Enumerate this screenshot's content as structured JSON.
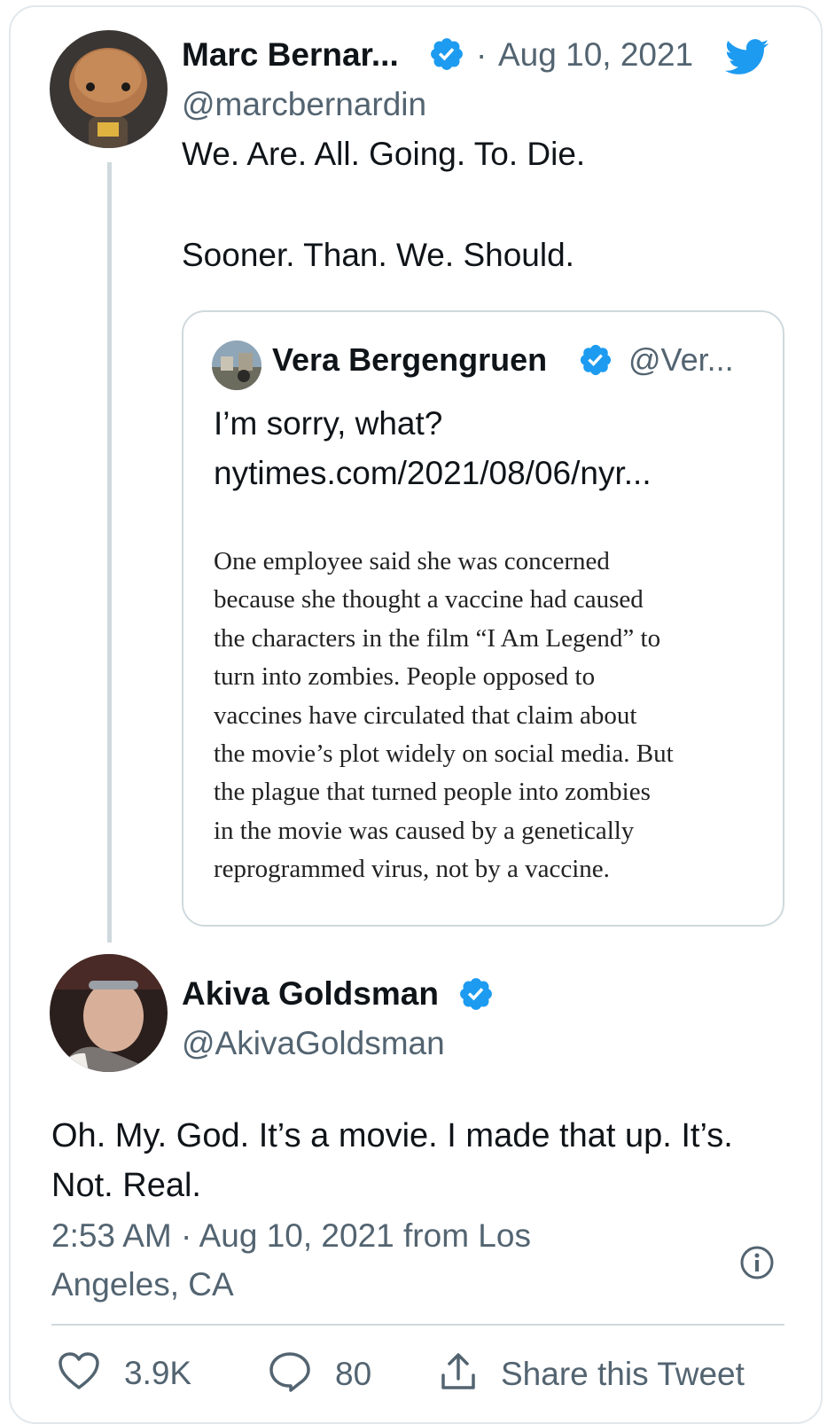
{
  "tweet1": {
    "display_name": "Marc Bernar...",
    "separator": "·",
    "date": "Aug 10, 2021",
    "handle": "@marcbernardin",
    "text_line1": "We. Are. All. Going. To. Die.",
    "text_line2": "Sooner. Than. We. Should."
  },
  "quoted": {
    "display_name": "Vera Bergengruen",
    "handle": "@Ver...",
    "text": "I’m sorry, what?",
    "link": "nytimes.com/2021/08/06/nyr...",
    "article_lines": [
      "One employee said she was concerned",
      "because she thought a vaccine had caused",
      "the characters in the film “I Am Legend” to",
      "turn into zombies. People opposed to",
      "vaccines have circulated that claim about",
      "the movie’s plot widely on social media. But",
      "the plague that turned people into zombies",
      "in the movie was caused by a genetically",
      "reprogrammed virus, not by a vaccine."
    ]
  },
  "tweet2": {
    "display_name": "Akiva Goldsman",
    "handle": "@AkivaGoldsman",
    "text_line1": "Oh. My. God. It’s a movie. I made that up. It’s.",
    "text_line2": "Not. Real.",
    "meta_line1": "2:53 AM · Aug 10, 2021 from Los",
    "meta_line2": "Angeles, CA"
  },
  "actions": {
    "likes": "3.9K",
    "replies": "80",
    "share_label": "Share this Tweet"
  },
  "colors": {
    "verified_blue": "#1d9bf0",
    "twitter_blue": "#1d9bf0",
    "muted_text": "#536471",
    "border": "#cfd9de"
  },
  "icons": {
    "verified": "verified-badge-icon",
    "logo": "twitter-bird-icon",
    "info": "info-icon",
    "like": "heart-icon",
    "reply": "reply-bubble-icon",
    "share": "share-upload-icon"
  }
}
